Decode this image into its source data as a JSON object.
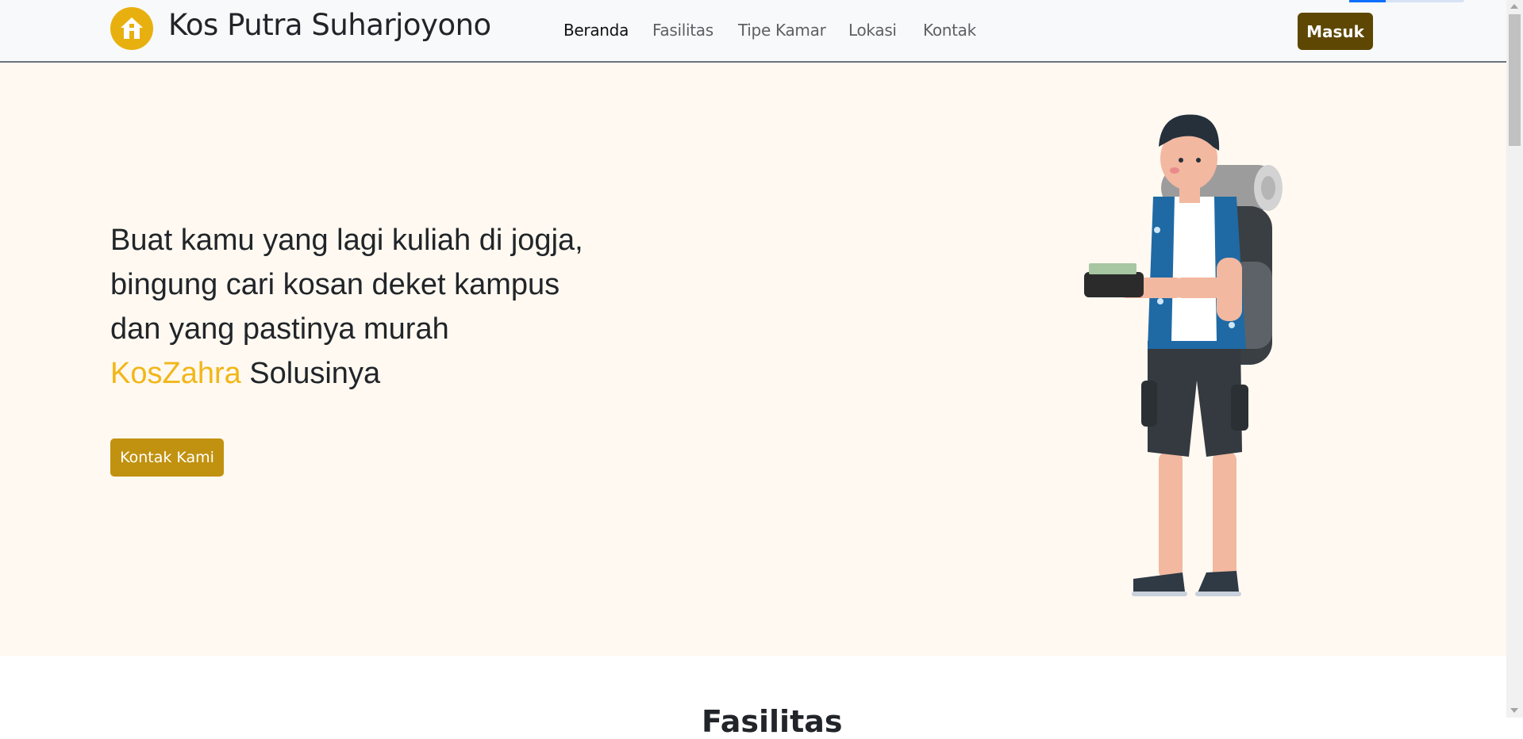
{
  "brand": {
    "name": "Kos Putra Suharjoyono",
    "logo_icon": "house-icon"
  },
  "nav": {
    "items": [
      {
        "label": "Beranda",
        "active": true
      },
      {
        "label": "Fasilitas",
        "active": false
      },
      {
        "label": "Tipe Kamar",
        "active": false
      },
      {
        "label": "Lokasi",
        "active": false
      },
      {
        "label": "Kontak",
        "active": false
      }
    ],
    "login_label": "Masuk"
  },
  "hero": {
    "line1": "Buat kamu yang lagi kuliah di jogja,",
    "line2": "bingung cari kosan deket kampus",
    "line3": "dan yang pastinya murah",
    "accent_word": "KosZahra",
    "line4_rest": " Solusinya",
    "cta_label": "Kontak Kami",
    "illustration": "backpacker-with-wallet-illustration"
  },
  "next_section": {
    "title": "Fasilitas"
  },
  "colors": {
    "accent": "#f2b618",
    "cta": "#c1920f",
    "login": "#5e4703",
    "hero_bg": "#fff9f1",
    "nav_bg": "#f8f9fa"
  }
}
